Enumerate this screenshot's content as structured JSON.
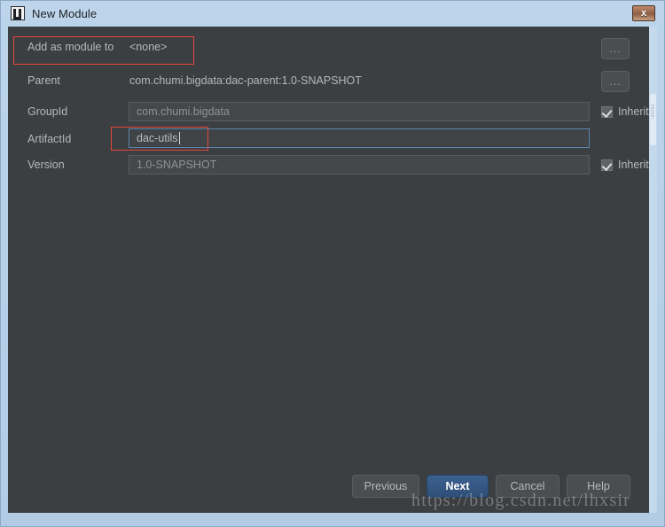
{
  "window": {
    "title": "New Module",
    "app_icon": "intellij-idea-icon",
    "close_label": "x",
    "frame_color": "#b2cce6",
    "content_bg": "#3c3f41"
  },
  "form": {
    "rows": [
      {
        "label": "Add as module to",
        "kind": "static",
        "value": "<none>",
        "has_browse_button": true,
        "browse_label": "...",
        "annotated": true
      },
      {
        "label": "Parent",
        "kind": "static",
        "value": "com.chumi.bigdata:dac-parent:1.0-SNAPSHOT",
        "has_browse_button": true,
        "browse_label": "...",
        "annotated": false
      },
      {
        "label": "GroupId",
        "kind": "input",
        "value": "com.chumi.bigdata",
        "placeholder": "com.chumi.bigdata",
        "focused": false,
        "inherit": {
          "label": "Inherit",
          "checked": true
        },
        "annotated": false
      },
      {
        "label": "ArtifactId",
        "kind": "input",
        "value": "dac-utils",
        "placeholder": "dac-utils",
        "focused": true,
        "inherit": null,
        "annotated": true
      },
      {
        "label": "Version",
        "kind": "input",
        "value": "1.0-SNAPSHOT",
        "placeholder": "1.0-SNAPSHOT",
        "focused": false,
        "inherit": {
          "label": "Inherit",
          "checked": true
        },
        "annotated": false
      }
    ]
  },
  "buttons": {
    "previous": "Previous",
    "next": "Next",
    "cancel": "Cancel",
    "help": "Help",
    "default_button": "Next",
    "default_color": "#2f4f78"
  },
  "annotations": {
    "color": "#e8453c",
    "count": 2
  },
  "watermark": {
    "text": "https://blog.csdn.net/lhxsir"
  }
}
